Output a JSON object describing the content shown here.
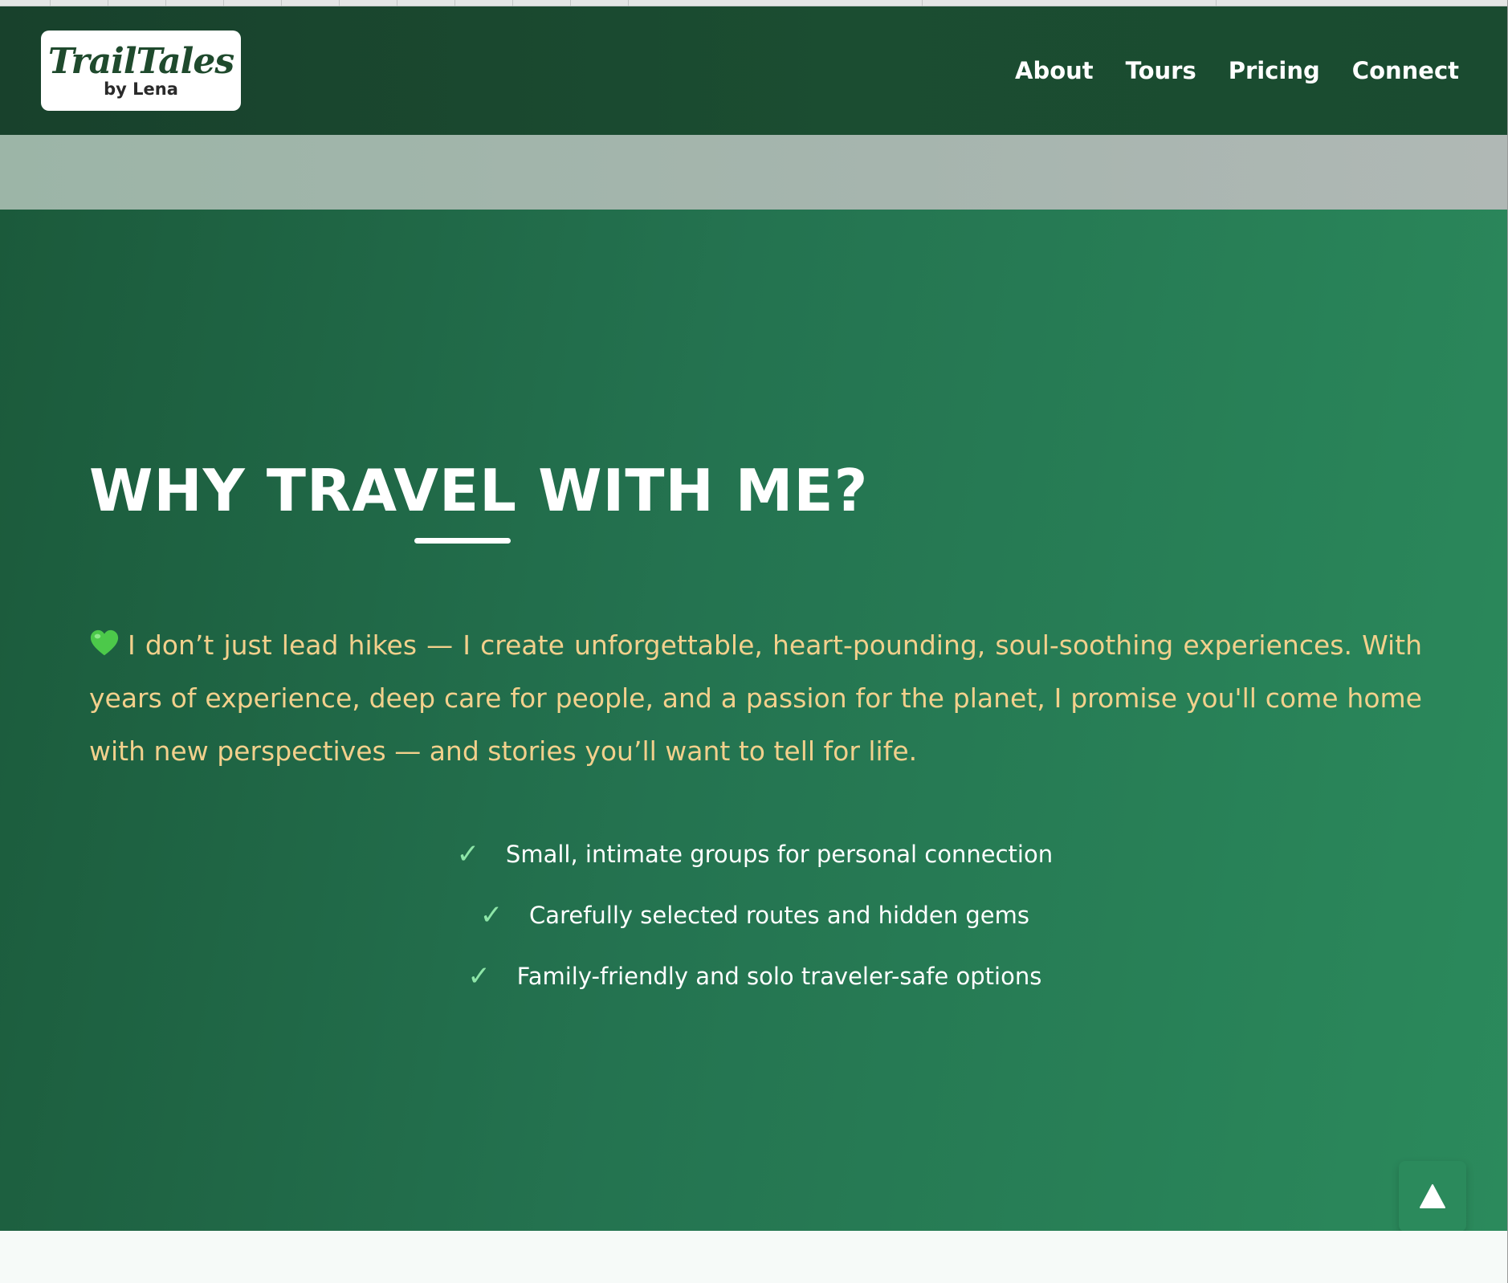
{
  "logo": {
    "script_text": "TrailTales",
    "sub_text": "by Lena"
  },
  "nav": {
    "items": [
      {
        "label": "About"
      },
      {
        "label": "Tours"
      },
      {
        "label": "Pricing"
      },
      {
        "label": "Connect"
      }
    ]
  },
  "why": {
    "heading": "WHY TRAVEL WITH ME?",
    "intro": "I don’t just lead hikes — I create unforgettable, heart-pounding, soul-soothing experiences. With years of experience, deep care for people, and a passion for the planet, I promise you'll come home with new perspectives — and stories you’ll want to tell for life.",
    "features": [
      {
        "check": "✓",
        "text": "Small, intimate groups for personal connection"
      },
      {
        "check": "✓",
        "text": "Carefully selected routes and hidden gems"
      },
      {
        "check": "✓",
        "text": "Family-friendly and solo traveler-safe options"
      }
    ]
  },
  "back_to_top": {
    "icon": "triangle-up-icon"
  },
  "colors": {
    "header_bg": "#1b4d31",
    "section_bg_start": "#1b5a3b",
    "section_bg_end": "#2b8a5c",
    "intro_text": "#f2d08c",
    "check": "#8ee6a8"
  }
}
